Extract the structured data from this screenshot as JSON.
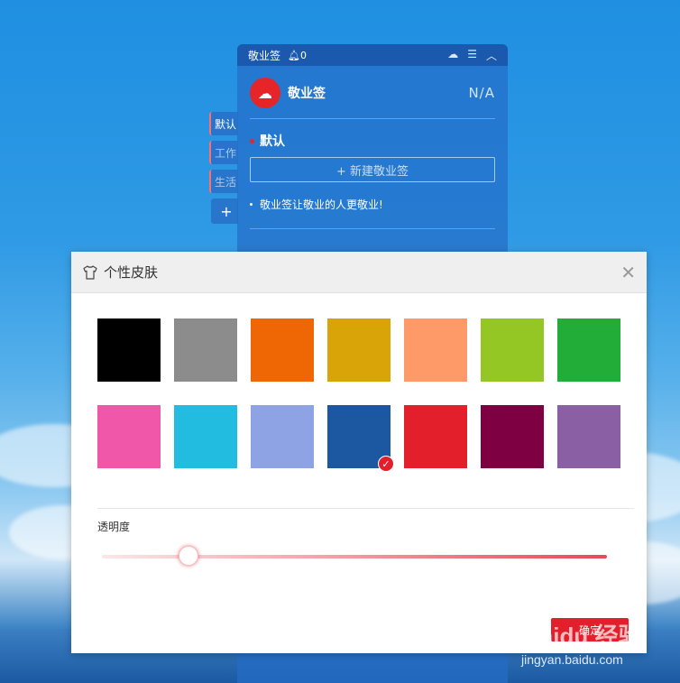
{
  "note": {
    "title": "敬业签",
    "bell_count": "0",
    "brand": "敬业签",
    "status": "N/A",
    "category": "默认",
    "new_button": "+ 新建敬业签",
    "items": [
      "敬业签让敬业的人更敬业!"
    ],
    "side_tabs": [
      "默认",
      "工作",
      "生活"
    ],
    "add_tab": "+"
  },
  "dialog": {
    "title": "个性皮肤",
    "close": "✕",
    "colors": [
      "#000000",
      "#8c8c8c",
      "#ef6605",
      "#d9a407",
      "#fd9a67",
      "#95c724",
      "#22ac38",
      "#f057a9",
      "#22bce0",
      "#8da3e3",
      "#1c57a1",
      "#e21f2b",
      "#7f0042",
      "#8a5fa3"
    ],
    "selected_color": "#1c57a1",
    "opacity_label": "透明度",
    "opacity_value": 0.17,
    "ok_button": "确定"
  },
  "watermark": {
    "line1": "Baidu 经验",
    "line2": "jingyan.baidu.com"
  }
}
